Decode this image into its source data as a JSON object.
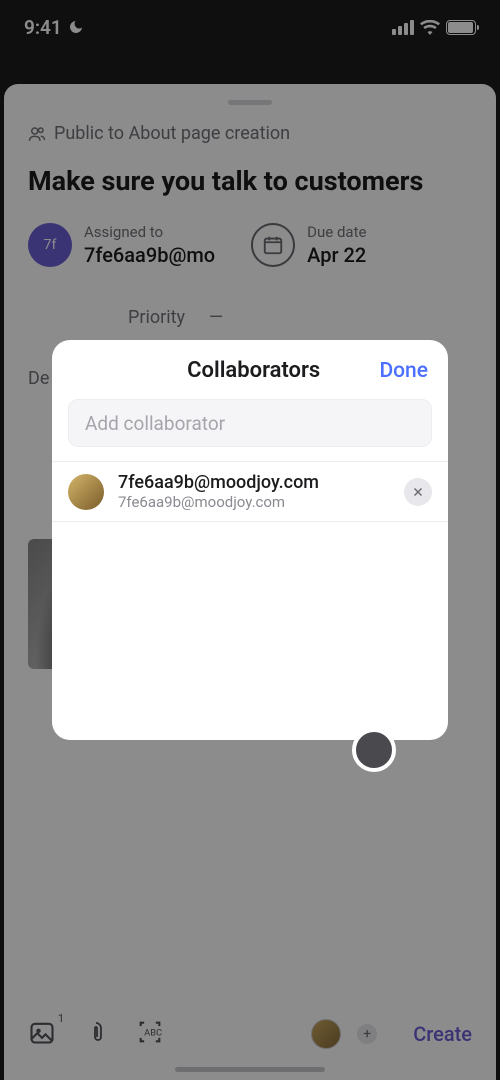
{
  "status": {
    "time": "9:41"
  },
  "task": {
    "visibility": "Public to About page creation",
    "title": "Make sure you talk to customers",
    "assigned_label": "Assigned to",
    "assigned_value": "7fe6aa9b@mo",
    "assigned_initials": "7f",
    "due_label": "Due date",
    "due_value": "Apr 22",
    "priority_label": "Priority",
    "priority_value": "—",
    "description_label": "De"
  },
  "bottombar": {
    "image_count": "1",
    "create_label": "Create"
  },
  "modal": {
    "title": "Collaborators",
    "done": "Done",
    "placeholder": "Add collaborator",
    "items": [
      {
        "name": "7fe6aa9b@moodjoy.com",
        "email": "7fe6aa9b@moodjoy.com"
      }
    ]
  }
}
